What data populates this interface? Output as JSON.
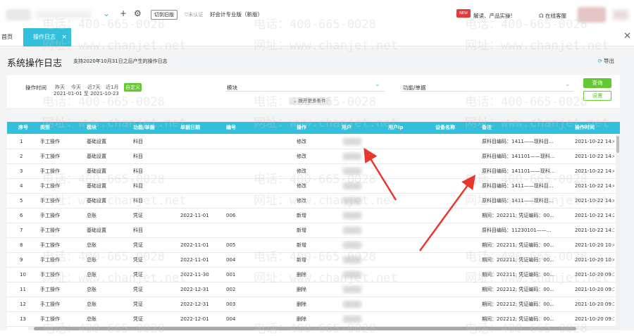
{
  "topbar": {
    "switch_old": "切到旧版",
    "unverified": "未认证",
    "edition": "好会计专业版（新版）",
    "new_badge": "NEW",
    "promo": "解读、产品实操!",
    "service": "在线客服"
  },
  "tabs": {
    "home": "首页",
    "active": "操作日志",
    "close_glyph": "×"
  },
  "header": {
    "title": "系统操作日志",
    "subtitle": "支持2020年10月31日之后产生的操作日志",
    "export": "导出"
  },
  "filters": {
    "time_label": "操作时间",
    "options": [
      "昨天",
      "今天",
      "近7天",
      "近1月"
    ],
    "custom": "自定义",
    "range": "2021-01-01 至 2021-10-23",
    "module_label": "模块",
    "function_label": "功能/单据",
    "expand": "展开更多条件",
    "query": "查询",
    "settings": "设置"
  },
  "table": {
    "columns": [
      "序号",
      "类型",
      "模块",
      "功能/单据",
      "单据日期",
      "编号",
      "操作",
      "用户",
      "用户ip",
      "设备名称",
      "备注",
      "操作时间"
    ],
    "rows": [
      [
        "1",
        "手工操作",
        "基础设置",
        "科目",
        "",
        "",
        "修改",
        "",
        "",
        "",
        "原科目编码：1411——现科目...",
        "2021-10-22 14:4"
      ],
      [
        "2",
        "手工操作",
        "基础设置",
        "科目",
        "",
        "",
        "修改",
        "",
        "",
        "",
        "原科目编码：141101——现科...",
        "2021-10-22 14:4"
      ],
      [
        "3",
        "手工操作",
        "基础设置",
        "科目",
        "",
        "",
        "修改",
        "",
        "",
        "",
        "原科目编码：141101——现科...",
        "2021-10-22 14:4"
      ],
      [
        "4",
        "手工操作",
        "基础设置",
        "科目",
        "",
        "",
        "修改",
        "",
        "",
        "",
        "原科目编码：1411——现科目...",
        "2021-10-22 14:4"
      ],
      [
        "5",
        "手工操作",
        "基础设置",
        "科目",
        "",
        "",
        "修改",
        "",
        "",
        "",
        "原科目编码：1411——现科目...",
        "2021-10-22 14:4"
      ],
      [
        "6",
        "手工操作",
        "总账",
        "凭证",
        "2022-11-01",
        "006",
        "新增",
        "",
        "",
        "",
        "期间：202211; 凭证编码：00...",
        "2021-10-22 14:2"
      ],
      [
        "7",
        "手工操作",
        "基础设置",
        "科目",
        "",
        "",
        "新增",
        "",
        "",
        "",
        "原科目编码：11230101——...",
        "2021-10-22 14:1"
      ],
      [
        "8",
        "手工操作",
        "总账",
        "凭证",
        "2022-11-01",
        "005",
        "新增",
        "",
        "",
        "",
        "期间：202211; 凭证编码：00...",
        "2021-10-20 10:4"
      ],
      [
        "9",
        "手工操作",
        "总账",
        "凭证",
        "2022-11-01",
        "004",
        "新增",
        "",
        "",
        "",
        "期间：202211; 凭证编码：00...",
        "2021-10-20 10:4"
      ],
      [
        "10",
        "手工操作",
        "总账",
        "凭证",
        "2022-11-30",
        "001",
        "删除",
        "",
        "",
        "",
        "期间：202211; 凭证编码：00...",
        "2021-10-20 09:1"
      ],
      [
        "11",
        "手工操作",
        "总账",
        "凭证",
        "2022-12-31",
        "002",
        "删除",
        "",
        "",
        "",
        "期间：202212; 凭证编码：00...",
        "2021-10-20 09:1"
      ],
      [
        "12",
        "手工操作",
        "总账",
        "凭证",
        "2022-12-31",
        "003",
        "删除",
        "",
        "",
        "",
        "期间：202212; 凭证编码：00...",
        "2021-10-20 09:1"
      ],
      [
        "13",
        "手工操作",
        "总账",
        "凭证",
        "2022-12-01",
        "004",
        "删除",
        "",
        "",
        "",
        "期间：202212; 凭证编码：00...",
        "2021-10-20 09:1"
      ]
    ]
  },
  "watermark": {
    "phone": "电话：400-665-0028",
    "site": "网址：www.chanjet.net"
  },
  "colors": {
    "accent": "#34c0dc",
    "green": "#64c832",
    "annotation_arrow": "#e8372c"
  }
}
